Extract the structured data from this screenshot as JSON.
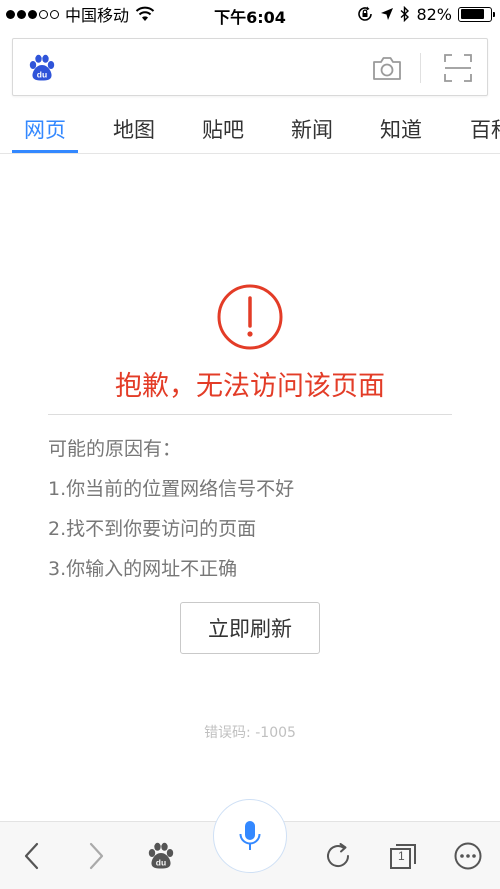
{
  "status_bar": {
    "carrier": "中国移动",
    "time": "下午6:04",
    "battery_percent": "82%",
    "battery_level": 0.82
  },
  "search": {
    "placeholder": "",
    "logo_icon": "baidu-paw-icon",
    "camera_icon": "camera-icon",
    "scan_icon": "scan-icon"
  },
  "tabs": [
    {
      "label": "网页",
      "active": true
    },
    {
      "label": "地图",
      "active": false
    },
    {
      "label": "贴吧",
      "active": false
    },
    {
      "label": "新闻",
      "active": false
    },
    {
      "label": "知道",
      "active": false
    },
    {
      "label": "百科",
      "active": false
    }
  ],
  "error": {
    "title": "抱歉，无法访问该页面",
    "reasons_heading": "可能的原因有：",
    "reasons": [
      "1.你当前的位置网络信号不好",
      "2.找不到你要访问的页面",
      "3.你输入的网址不正确"
    ],
    "refresh_label": "立即刷新",
    "code": "错误码: -1005"
  },
  "toolbar": {
    "tab_count": "1"
  },
  "colors": {
    "accent": "#3388ff",
    "error": "#e33c27"
  }
}
